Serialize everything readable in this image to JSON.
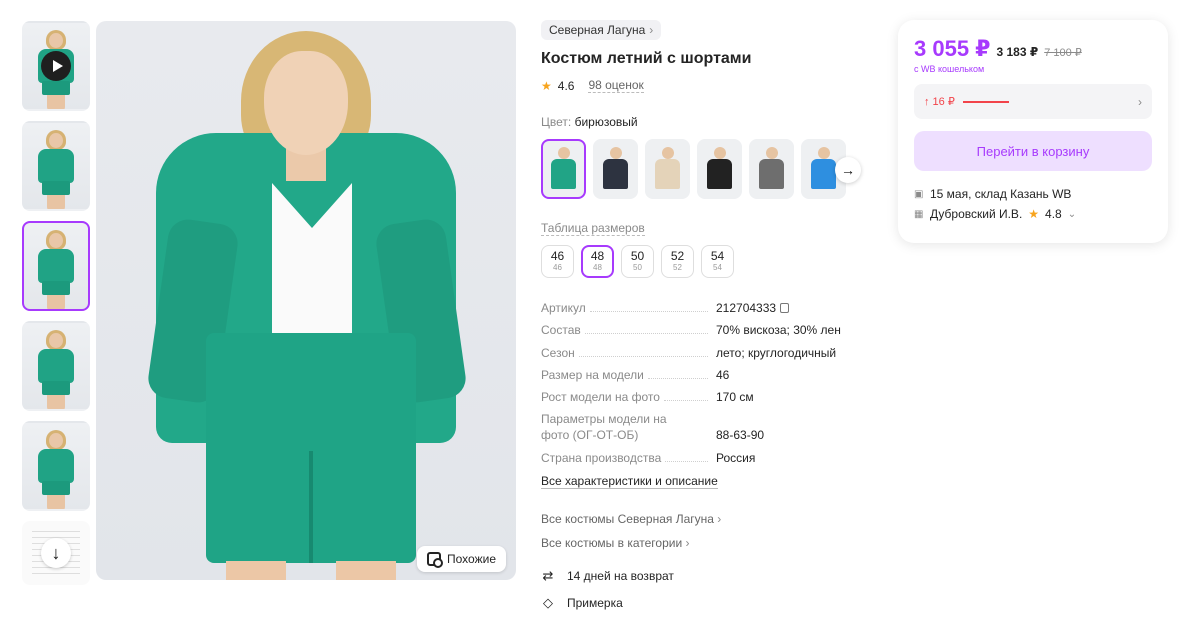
{
  "gallery": {
    "thumbnails": [
      {
        "type": "video"
      },
      {
        "type": "photo"
      },
      {
        "type": "photo",
        "active": true
      },
      {
        "type": "photo"
      },
      {
        "type": "photo"
      },
      {
        "type": "size-chart"
      }
    ],
    "similar_label": "Похожие"
  },
  "product": {
    "brand": "Северная Лагуна",
    "title": "Костюм летний с шортами",
    "rating": "4.6",
    "reviews": "98 оценок",
    "color_label": "Цвет:",
    "color_value": "бирюзовый",
    "swatch_colors": [
      "#21a486",
      "#2d3340",
      "#e4d3b9",
      "#222222",
      "#6e6e6e",
      "#2e8fe0"
    ],
    "size_table_label": "Таблица размеров",
    "sizes": [
      {
        "main": "46",
        "sub": "46"
      },
      {
        "main": "48",
        "sub": "48",
        "active": true
      },
      {
        "main": "50",
        "sub": "50"
      },
      {
        "main": "52",
        "sub": "52"
      },
      {
        "main": "54",
        "sub": "54"
      }
    ],
    "specs": [
      {
        "key": "Артикул",
        "value": "212704333"
      },
      {
        "key": "Состав",
        "value": "70% вискоза; 30% лен"
      },
      {
        "key": "Сезон",
        "value": "лето; круглогодичный"
      },
      {
        "key": "Размер на модели",
        "value": "46"
      },
      {
        "key": "Рост модели на фото",
        "value": "170 см"
      },
      {
        "key": "Параметры модели на фото (ОГ-ОТ-ОБ)",
        "value": "88-63-90"
      },
      {
        "key": "Страна производства",
        "value": "Россия"
      }
    ],
    "all_specs_link": "Все характеристики и описание",
    "links": [
      "Все костюмы Северная Лагуна",
      "Все костюмы в категории"
    ],
    "perks": [
      {
        "icon": "return-arrows-icon",
        "label": "14 дней на возврат"
      },
      {
        "icon": "tag-icon",
        "label": "Примерка"
      }
    ]
  },
  "price_card": {
    "price": "3 055 ₽",
    "alt_price": "3 183 ₽",
    "old_price": "7 100 ₽",
    "wallet_note": "с WB кошельком",
    "history": "↑ 16 ₽",
    "cart_button": "Перейти в корзину",
    "delivery": "15 мая, склад Казань WB",
    "seller": "Дубровский И.В.",
    "seller_rating": "4.8"
  },
  "colors": {
    "accent": "#a73afd",
    "price": "#a73afd",
    "up": "#f2434a",
    "star": "#f7a41d"
  }
}
